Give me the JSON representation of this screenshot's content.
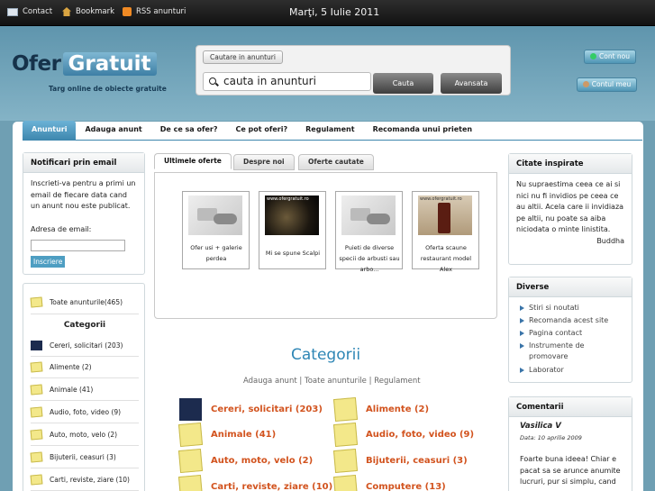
{
  "topbar": {
    "contact": "Contact",
    "bookmark": "Bookmark",
    "rss": "RSS anunturi",
    "date": "Marţi, 5 Iulie 2011"
  },
  "logo": {
    "part1": "Ofer",
    "part2": "Gratuit",
    "tagline": "Targ online de obiecte gratuite"
  },
  "search": {
    "tab": "Cautare in anunturi",
    "value": "cauta in anunturi",
    "search_btn": "Cauta",
    "advanced_btn": "Avansata"
  },
  "account": {
    "new": "Cont nou",
    "my": "Contul meu"
  },
  "nav": [
    "Anunturi",
    "Adauga anunt",
    "De ce sa ofer?",
    "Ce pot oferi?",
    "Regulament",
    "Recomanda unui prieten"
  ],
  "notify": {
    "title": "Notificari prin email",
    "text": "Inscrieti-va pentru a primi un email de fiecare data cand un anunt nou este publicat.",
    "label": "Adresa de email:",
    "button": "Inscriere"
  },
  "sidebar": {
    "all": "Toate anunturile(465)",
    "cat_title": "Categorii",
    "cats": [
      "Cereri, solicitari (203)",
      "Alimente (2)",
      "Animale (41)",
      "Audio, foto, video (9)",
      "Auto, moto, velo (2)",
      "Bijuterii, ceasuri (3)",
      "Carti, reviste, ziare (10)"
    ]
  },
  "tabs": [
    "Ultimele oferte",
    "Despre noi",
    "Oferte cautate"
  ],
  "offers": [
    "Ofer usi + galerie perdea",
    "Mi se spune Scalpi",
    "Puieti de diverse specii de arbusti sau arbo...",
    "Oferta scaune restaurant model Alex"
  ],
  "offer_img_caption": "www.ofergratuit.ro",
  "categories": {
    "title": "Categorii",
    "link1": "Adauga anunt",
    "link2": "Toate anunturile",
    "link3": "Regulament",
    "left": [
      "Cereri, solicitari (203)",
      "Animale (41)",
      "Auto, moto, velo (2)",
      "Carti, reviste, ziare (10)"
    ],
    "right": [
      "Alimente (2)",
      "Audio, foto, video (9)",
      "Bijuterii, ceasuri (3)",
      "Computere (13)"
    ]
  },
  "quote": {
    "title": "Citate inspirate",
    "text": "Nu supraestima ceea ce ai si nici nu fi invidios pe ceea ce au altii. Acela care ii invidiaza pe altii, nu poate sa aiba niciodata o minte linistita.",
    "author": "Buddha"
  },
  "misc": {
    "title": "Diverse",
    "items": [
      "Stiri si noutati",
      "Recomanda acest site",
      "Pagina contact",
      "Instrumente de promovare",
      "Laborator"
    ]
  },
  "comments": {
    "title": "Comentarii",
    "name": "Vasilica V",
    "date": "Data: 10 aprilie 2009",
    "text": "Foarte buna ideea! Chiar e pacat sa se arunce anumite lucruri, pur si simplu, cand"
  },
  "colors": {
    "accent": "#3d86ad",
    "category_link": "#d2531e",
    "title_blue": "#2e86b5",
    "topbar": "#1a1a1a"
  }
}
